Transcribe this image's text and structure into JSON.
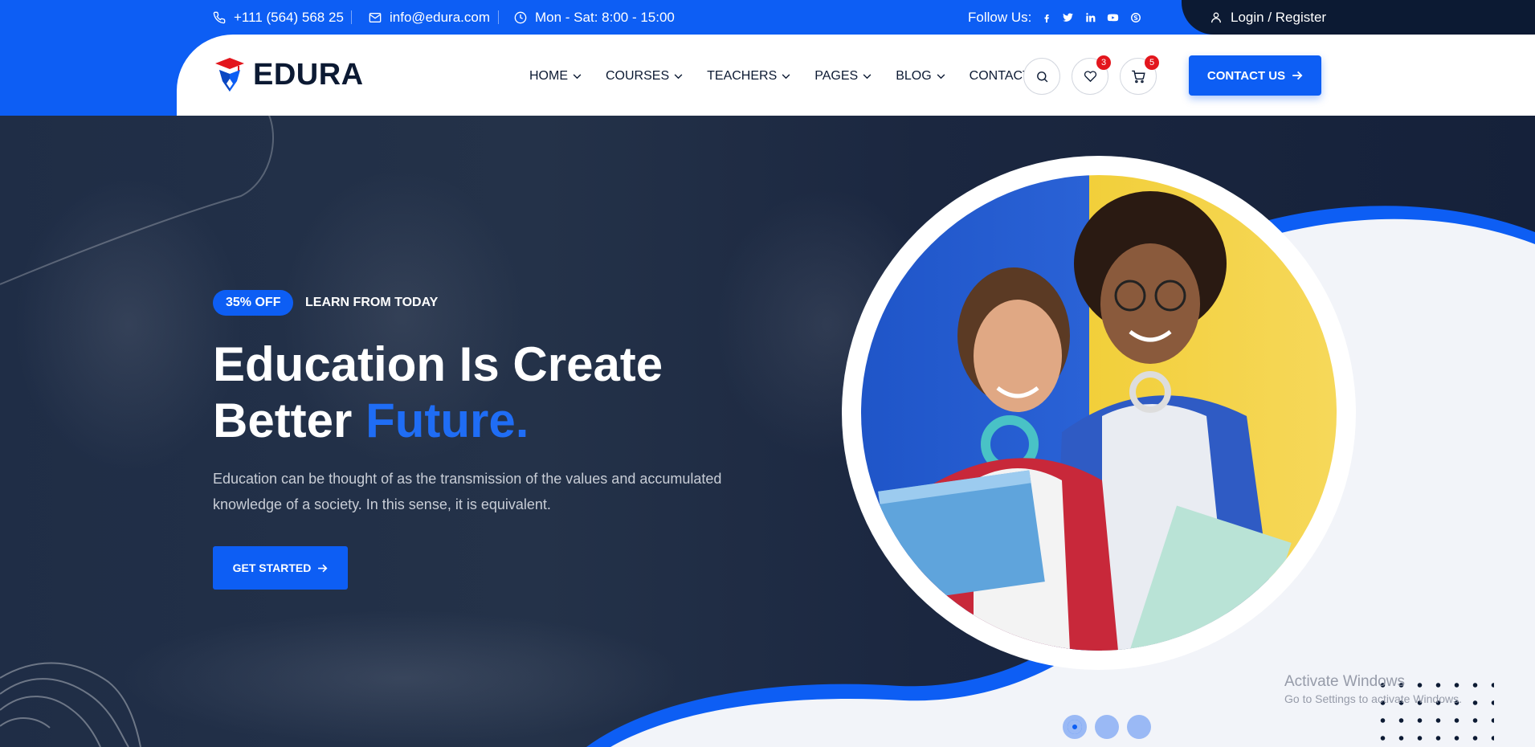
{
  "topbar": {
    "phone": "+111 (564) 568 25",
    "email": "info@edura.com",
    "hours": "Mon - Sat: 8:00 - 15:00",
    "follow_label": "Follow Us:",
    "social": [
      "facebook-icon",
      "twitter-icon",
      "linkedin-icon",
      "youtube-icon",
      "skype-icon"
    ],
    "login_label": "Login / Register"
  },
  "header": {
    "logo_text": "EDURA",
    "nav": [
      {
        "label": "HOME",
        "dropdown": true
      },
      {
        "label": "COURSES",
        "dropdown": true
      },
      {
        "label": "TEACHERS",
        "dropdown": true
      },
      {
        "label": "PAGES",
        "dropdown": true
      },
      {
        "label": "BLOG",
        "dropdown": true
      },
      {
        "label": "CONTACT",
        "dropdown": false
      }
    ],
    "wishlist_count": "3",
    "cart_count": "5",
    "contact_button": "CONTACT US"
  },
  "hero": {
    "discount_badge": "35% OFF",
    "tagline": "LEARN FROM TODAY",
    "title_line1": "Education Is Create",
    "title_line2": "Better ",
    "title_accent": "Future.",
    "description": "Education can be thought of as the transmission of the values and accumulated knowledge of a society. In this sense, it is equivalent.",
    "cta": "GET STARTED"
  },
  "slider": {
    "active_index": 0,
    "count": 3
  },
  "watermark": {
    "title": "Activate Windows",
    "subtitle": "Go to Settings to activate Windows."
  },
  "colors": {
    "primary": "#0d5ef4",
    "dark": "#0c1a33",
    "accent_red": "#e3161d"
  }
}
